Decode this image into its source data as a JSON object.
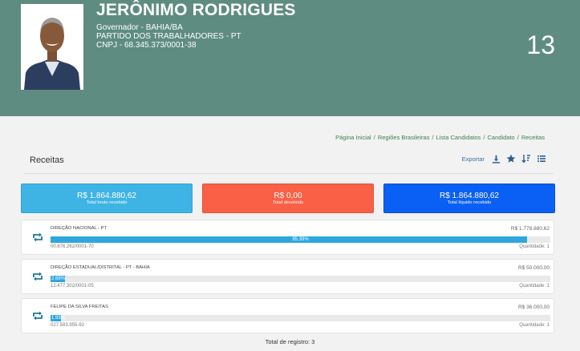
{
  "candidate": {
    "name": "JERÔNIMO RODRIGUES",
    "office": "Governador - BAHIA/BA",
    "party": "PARTIDO DOS TRABALHADORES - PT",
    "cnpj": "CNPJ - 68.345.373/0001-38",
    "number": "13"
  },
  "breadcrumb": [
    "Página Inicial",
    "Regiões Brasileiras",
    "Lista Candidatos",
    "Candidato",
    "Receitas"
  ],
  "section": {
    "title": "Receitas",
    "export_label": "Exportar",
    "icons": [
      "download-icon",
      "star-icon",
      "sort-icon",
      "list-icon"
    ]
  },
  "summary": [
    {
      "amount": "R$ 1.864.880,62",
      "caption": "Total bruto recebido",
      "color": "#3eb4e5"
    },
    {
      "amount": "R$ 0,00",
      "caption": "Total devolvido",
      "color": "#f96045"
    },
    {
      "amount": "R$ 1.864.880,62",
      "caption": "Total líquido recebido",
      "color": "#0a5ff5"
    }
  ],
  "donors": [
    {
      "name": "DIREÇÃO NACIONAL - PT",
      "amount": "R$ 1.778.880,62",
      "percent": 95.39,
      "percent_label": "95.39%",
      "doc": "00.676.262/0001-70",
      "quantity": "Quantidade: 1"
    },
    {
      "name": "DIREÇÃO ESTADUAL/DISTRITAL - PT - BAHIA",
      "amount": "R$ 50.000,00",
      "percent": 2.68,
      "percent_label": "2.68%",
      "doc": "12.477.302/0001-05",
      "quantity": "Quantidade: 1"
    },
    {
      "name": "FELIPE DA SILVA FREITAS",
      "amount": "R$ 36.000,00",
      "percent": 1.93,
      "percent_label": "1.93%",
      "doc": "027.583.955-92",
      "quantity": "Quantidade: 1"
    }
  ],
  "total_records": "Total de registro: 3",
  "colors": {
    "header": "#5e8c80",
    "progress": "#2ea7dd",
    "link": "#3a6fa3",
    "breadcrumb": "#3c7f4e"
  }
}
